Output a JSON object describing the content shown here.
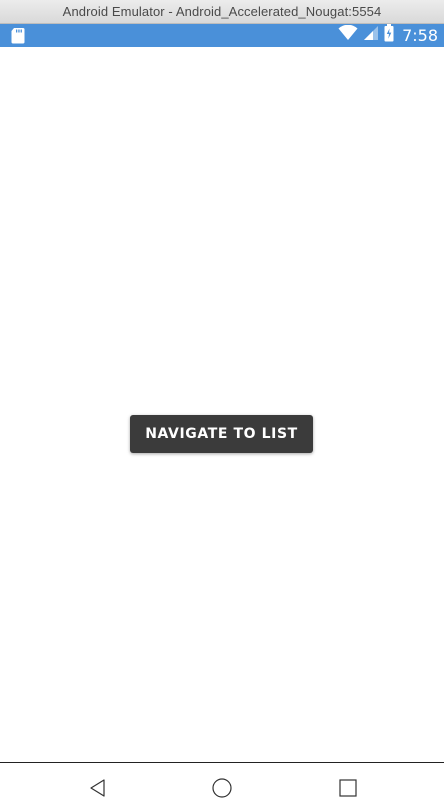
{
  "window": {
    "title": "Android Emulator - Android_Accelerated_Nougat:5554"
  },
  "status_bar": {
    "time": "7:58",
    "background_color": "#4a90d9",
    "icons": [
      "sd-card-icon",
      "wifi-icon",
      "cell-signal-icon",
      "battery-icon"
    ]
  },
  "main": {
    "navigate_button_label": "NAVIGATE TO LIST",
    "button_color": "#3b3b3b"
  },
  "nav_bar": {
    "icons": [
      "back-icon",
      "home-icon",
      "recents-icon"
    ]
  }
}
